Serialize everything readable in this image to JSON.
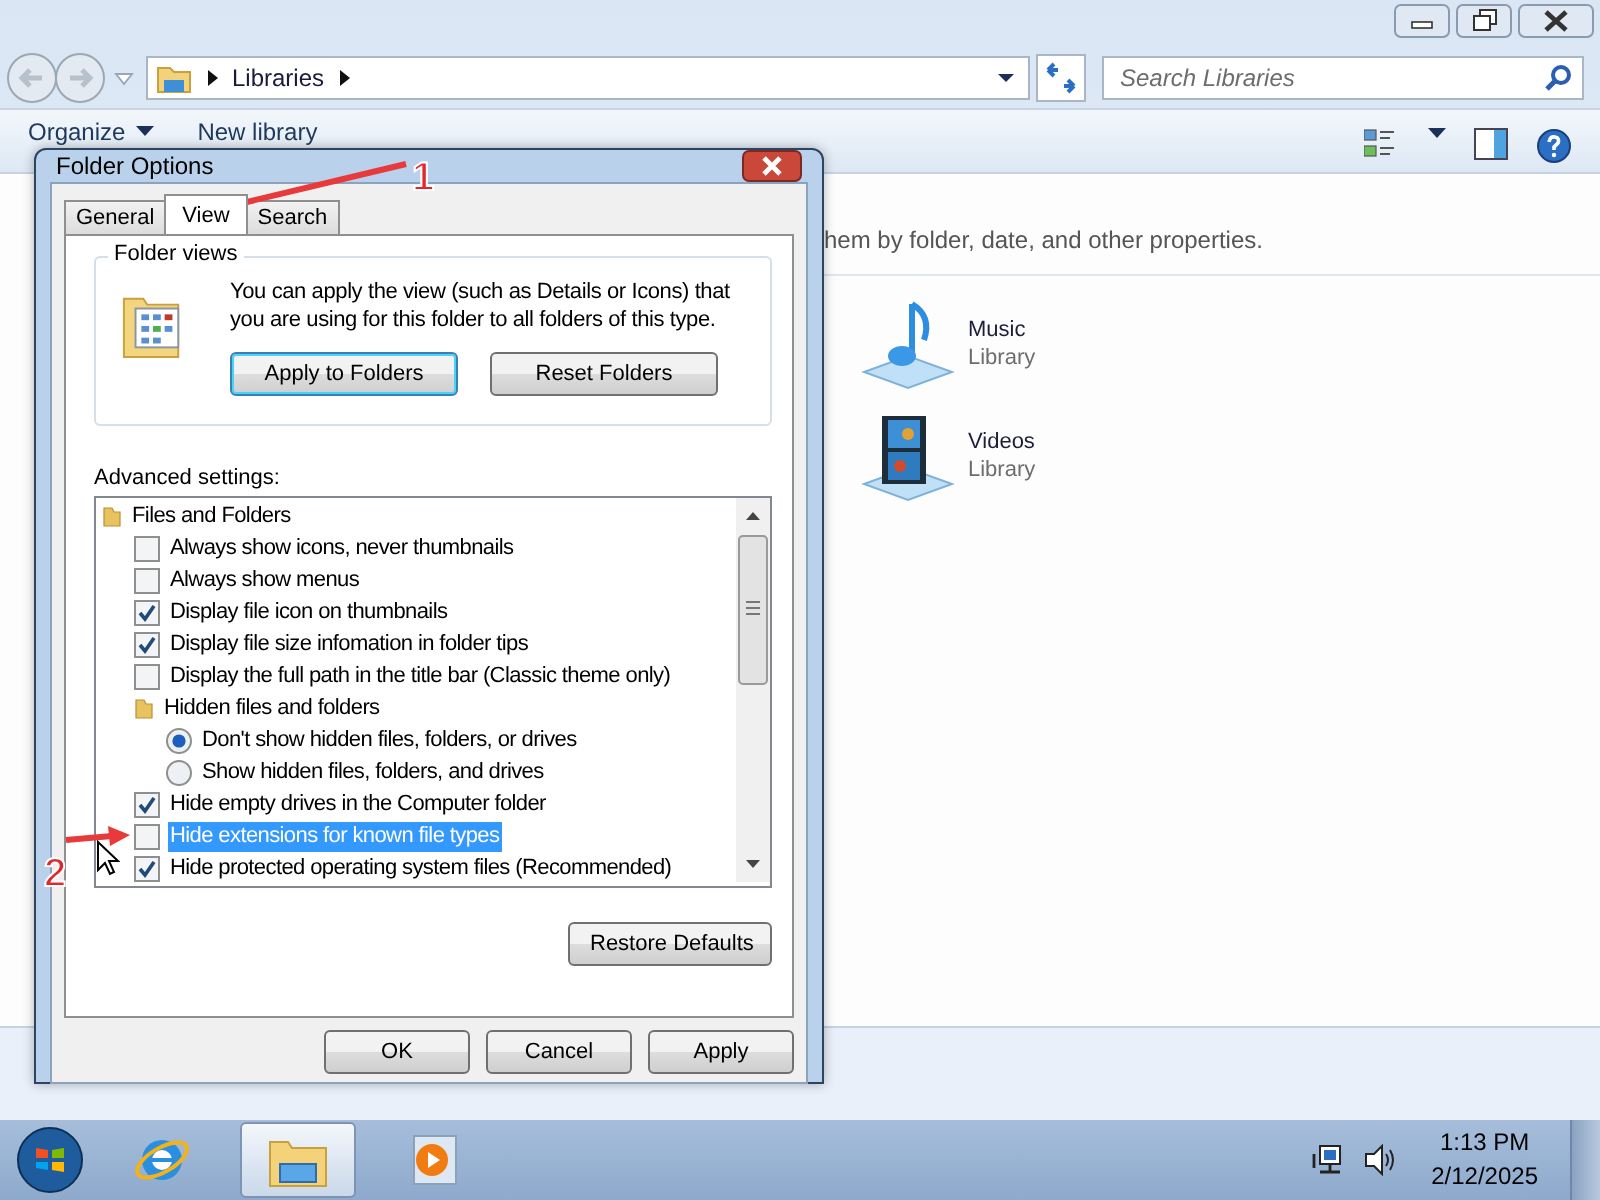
{
  "explorer": {
    "address": {
      "crumbs": [
        "Libraries"
      ]
    },
    "search": {
      "placeholder": "Search Libraries"
    },
    "toolbar": [
      "Organize",
      "New library"
    ],
    "content": {
      "description": "hem by folder, date, and other properties.",
      "libraries": [
        {
          "name": "Music",
          "type": "Library",
          "kind": "music"
        },
        {
          "name": "Videos",
          "type": "Library",
          "kind": "videos"
        }
      ]
    }
  },
  "dialog": {
    "title": "Folder Options",
    "tabs": [
      {
        "label": "General",
        "selected": false
      },
      {
        "label": "View",
        "selected": true
      },
      {
        "label": "Search",
        "selected": false
      }
    ],
    "folder_views": {
      "legend": "Folder views",
      "text": "You can apply the view (such as Details or Icons) that you are using for this folder to all folders of this type.",
      "buttons": [
        "Apply to Folders",
        "Reset Folders"
      ]
    },
    "advanced_label": "Advanced settings:",
    "tree": [
      {
        "kind": "folder",
        "label": "Files and Folders",
        "selected": false,
        "children": [
          {
            "kind": "checkbox",
            "label": "Always show icons, never thumbnails",
            "checked": false,
            "selected": false
          },
          {
            "kind": "checkbox",
            "label": "Always show menus",
            "checked": false,
            "selected": false
          },
          {
            "kind": "checkbox",
            "label": "Display file icon on thumbnails",
            "checked": true,
            "selected": false
          },
          {
            "kind": "checkbox",
            "label": "Display file size infomation in folder tips",
            "checked": true,
            "selected": false
          },
          {
            "kind": "checkbox",
            "label": "Display the full path in the title bar (Classic theme only)",
            "checked": false,
            "selected": false
          },
          {
            "kind": "folder",
            "label": "Hidden files and folders",
            "selected": false,
            "children": [
              {
                "kind": "radio",
                "label": "Don't show hidden files, folders, or drives",
                "checked": true,
                "selected": false
              },
              {
                "kind": "radio",
                "label": "Show hidden files, folders, and drives",
                "checked": false,
                "selected": false
              }
            ]
          },
          {
            "kind": "checkbox",
            "label": "Hide empty drives in the Computer folder",
            "checked": true,
            "selected": false
          },
          {
            "kind": "checkbox",
            "label": "Hide extensions for known file types",
            "checked": false,
            "selected": true
          },
          {
            "kind": "checkbox",
            "label": "Hide protected operating system files (Recommended)",
            "checked": true,
            "selected": false
          }
        ]
      }
    ],
    "restore_button": "Restore Defaults",
    "buttons": [
      "OK",
      "Cancel",
      "Apply"
    ]
  },
  "annotations": [
    {
      "label": "1"
    },
    {
      "label": "2"
    }
  ],
  "taskbar": {
    "apps": [
      {
        "kind": "ie",
        "selected": false
      },
      {
        "kind": "explorer",
        "selected": true
      },
      {
        "kind": "media",
        "selected": false
      }
    ],
    "time": "1:13 PM",
    "date": "2/12/2025"
  }
}
